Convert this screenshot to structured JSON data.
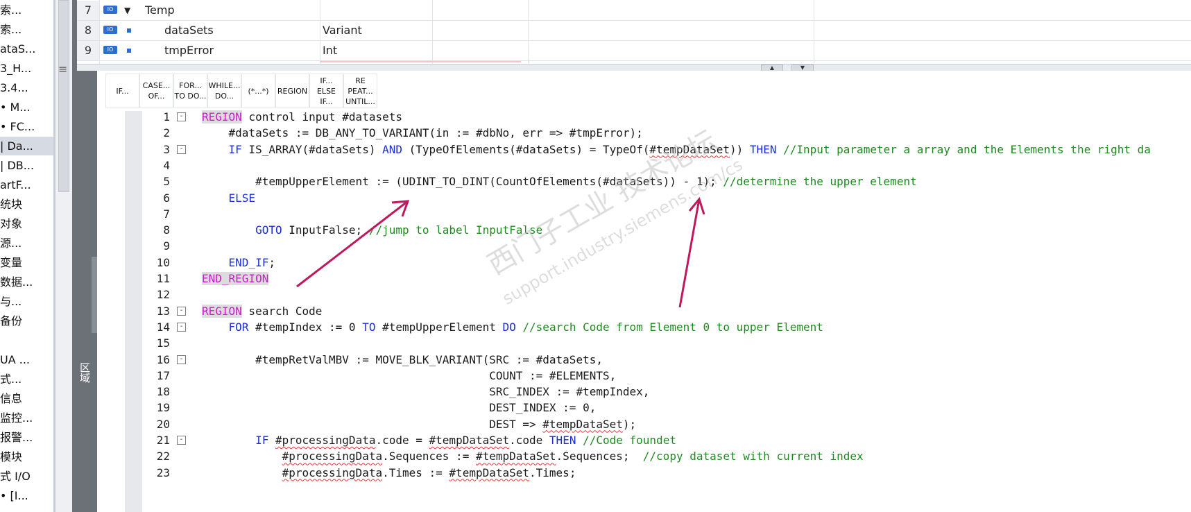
{
  "project_tree": {
    "items": [
      "索...",
      "索...",
      "ataS...",
      "3_H...",
      "3.4...",
      "• M...",
      "• FC...",
      "| Da...",
      "| DB...",
      "artF...",
      "统块",
      "对象",
      "源...",
      "变量",
      "数据...",
      "与...",
      "备份",
      "",
      "UA ...",
      "式...",
      "信息",
      "监控...",
      "报警...",
      "模块",
      "式 I/O",
      "• [I..."
    ],
    "selected_index": 7
  },
  "interface_grid": {
    "rows": [
      {
        "num": "7",
        "io": "IO",
        "expanded": true,
        "name": "Temp",
        "type": ""
      },
      {
        "num": "8",
        "io": "IO",
        "expanded": false,
        "name": "dataSets",
        "type": "Variant"
      },
      {
        "num": "9",
        "io": "IO",
        "expanded": false,
        "name": "tmpError",
        "type": "Int"
      }
    ]
  },
  "side_panel": {
    "label": "区域"
  },
  "toolbar": {
    "buttons": [
      "IF...",
      "CASE...\nOF...",
      "FOR...\nTO DO...",
      "WHILE...\nDO...",
      "(*...*)",
      "REGION",
      "IF...\nELSE\nIF...",
      "RE\nPEAT...\nUNTIL..."
    ]
  },
  "code_lines": [
    {
      "n": "1",
      "fold": "-",
      "text": "REGION control input #datasets"
    },
    {
      "n": "2",
      "fold": "",
      "text": "    #dataSets := DB_ANY_TO_VARIANT(in := #dbNo, err => #tmpError);"
    },
    {
      "n": "3",
      "fold": "-",
      "text": "    IF IS_ARRAY(#dataSets) AND (TypeOfElements(#dataSets) = TypeOf(#tempDataSet)) THEN //Input parameter a array and the Elements the right da"
    },
    {
      "n": "4",
      "fold": "",
      "text": ""
    },
    {
      "n": "5",
      "fold": "",
      "text": "        #tempUpperElement := (UDINT_TO_DINT(CountOfElements(#dataSets)) - 1); //determine the upper element"
    },
    {
      "n": "6",
      "fold": "",
      "text": "    ELSE"
    },
    {
      "n": "7",
      "fold": "",
      "text": ""
    },
    {
      "n": "8",
      "fold": "",
      "text": "        GOTO InputFalse; //jump to label InputFalse"
    },
    {
      "n": "9",
      "fold": "",
      "text": ""
    },
    {
      "n": "10",
      "fold": "",
      "text": "    END_IF;"
    },
    {
      "n": "11",
      "fold": "",
      "text": "END_REGION"
    },
    {
      "n": "12",
      "fold": "",
      "text": ""
    },
    {
      "n": "13",
      "fold": "-",
      "text": "REGION search Code"
    },
    {
      "n": "14",
      "fold": "-",
      "text": "    FOR #tempIndex := 0 TO #tempUpperElement DO //search Code from Element 0 to upper Element"
    },
    {
      "n": "15",
      "fold": "",
      "text": ""
    },
    {
      "n": "16",
      "fold": "-",
      "text": "        #tempRetValMBV := MOVE_BLK_VARIANT(SRC := #dataSets,"
    },
    {
      "n": "17",
      "fold": "",
      "text": "                                           COUNT := #ELEMENTS,"
    },
    {
      "n": "18",
      "fold": "",
      "text": "                                           SRC_INDEX := #tempIndex,"
    },
    {
      "n": "19",
      "fold": "",
      "text": "                                           DEST_INDEX := 0,"
    },
    {
      "n": "20",
      "fold": "",
      "text": "                                           DEST => #tempDataSet);"
    },
    {
      "n": "21",
      "fold": "-",
      "text": "        IF #processingData.code = #tempDataSet.code THEN //Code foundet"
    },
    {
      "n": "22",
      "fold": "",
      "text": "            #processingData.Sequences := #tempDataSet.Sequences;  //copy dataset with current index"
    },
    {
      "n": "23",
      "fold": "",
      "text": "            #processingData.Times := #tempDataSet.Times;"
    }
  ],
  "watermark": {
    "line1": "西门子工业 技术论坛",
    "line2": "support.industry.siemens.com/cs"
  },
  "colors": {
    "keyword": "#1a2fd8",
    "region": "#c71fc7",
    "comment": "#1f8a1f",
    "arrow": "#c0185c"
  }
}
